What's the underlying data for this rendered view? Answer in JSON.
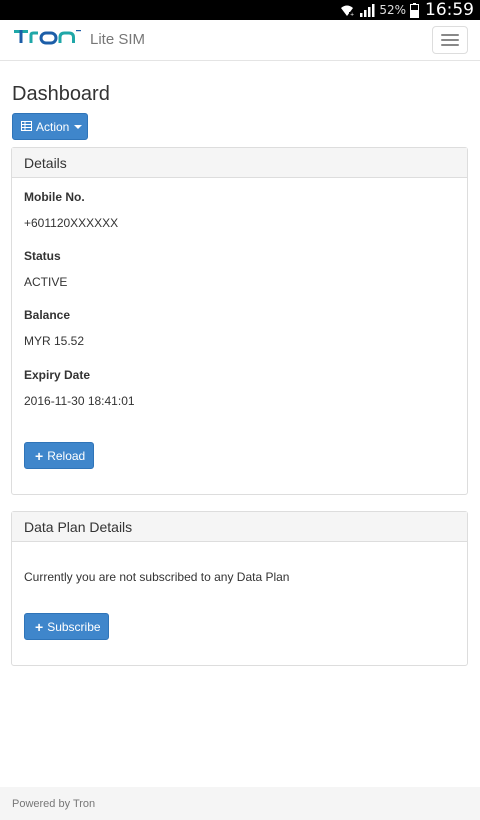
{
  "status_bar": {
    "battery_percent": "52%",
    "time": "16:59"
  },
  "navbar": {
    "brand_logo": "Tron",
    "brand_text": "Lite SIM",
    "menu_icon": "hamburger-icon"
  },
  "page": {
    "title": "Dashboard",
    "action_label": "Action"
  },
  "details": {
    "heading": "Details",
    "fields": [
      {
        "label": "Mobile No.",
        "value": "+601120XXXXXX"
      },
      {
        "label": "Status",
        "value": "ACTIVE"
      },
      {
        "label": "Balance",
        "value": "MYR 15.52"
      },
      {
        "label": "Expiry Date",
        "value": "2016-11-30 18:41:01"
      }
    ],
    "reload_label": "Reload"
  },
  "data_plan": {
    "heading": "Data Plan Details",
    "message": "Currently you are not subscribed to any Data Plan",
    "subscribe_label": "Subscribe"
  },
  "footer": {
    "text": "Powered by Tron"
  },
  "colors": {
    "primary": "#3f86cb",
    "brand_teal": "#1fa7a8",
    "brand_blue": "#1c5ea8"
  }
}
